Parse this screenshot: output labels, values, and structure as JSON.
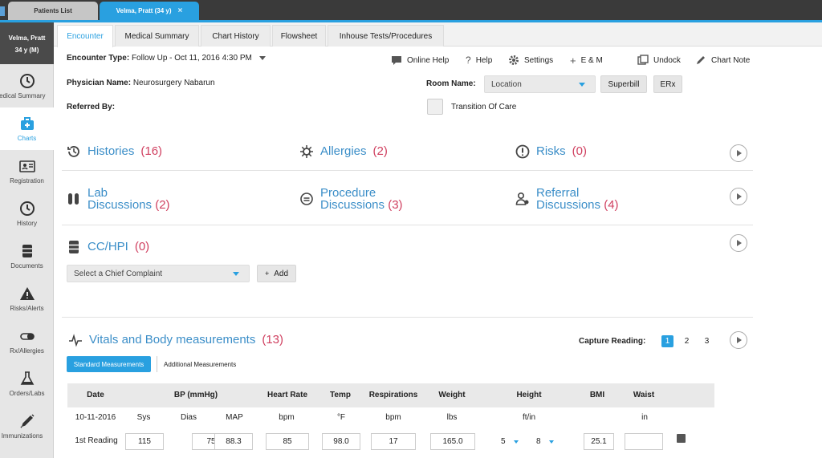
{
  "tabs": {
    "patients_list": "Patients List",
    "patient_tab": "Velma, Pratt (34 y)",
    "close": "×"
  },
  "patient": {
    "name": "Velma, Pratt",
    "age_sex": "34 y (M)"
  },
  "sidebar": {
    "items": [
      {
        "label": "Medical Summary"
      },
      {
        "label": "Charts"
      },
      {
        "label": "Registration"
      },
      {
        "label": "History"
      },
      {
        "label": "Documents"
      },
      {
        "label": "Risks/Alerts"
      },
      {
        "label": "Rx/Allergies"
      },
      {
        "label": "Orders/Labs"
      },
      {
        "label": "Immunizations"
      }
    ]
  },
  "subtabs": [
    "Encounter",
    "Medical Summary",
    "Chart History",
    "Flowsheet",
    "Inhouse Tests/Procedures"
  ],
  "encounter": {
    "type_label": "Encounter Type:",
    "type_value": "Follow Up - Oct 11, 2016 4:30 PM",
    "physician_label": "Physician Name:",
    "physician_value": "Neurosurgery Nabarun",
    "referred_label": "Referred By:",
    "room_label": "Room Name:",
    "room_placeholder": "Location",
    "transition_label": "Transition Of Care"
  },
  "toolbar": {
    "online_help": "Online Help",
    "help": "Help",
    "settings": "Settings",
    "em": "E & M",
    "undock": "Undock",
    "chart_note": "Chart Note",
    "superbill": "Superbill",
    "erx": "ERx"
  },
  "sections": {
    "histories": {
      "title": "Histories",
      "count": "(16)"
    },
    "allergies": {
      "title": "Allergies",
      "count": "(2)"
    },
    "risks": {
      "title": "Risks",
      "count": "(0)"
    },
    "lab": {
      "title1": "Lab",
      "title2": "Discussions",
      "count": "(2)"
    },
    "procedure": {
      "title1": "Procedure",
      "title2": "Discussions",
      "count": "(3)"
    },
    "referral": {
      "title1": "Referral",
      "title2": "Discussions",
      "count": "(4)"
    },
    "cchpi": {
      "title": "CC/HPI",
      "count": "(0)"
    },
    "vitals": {
      "title": "Vitals and Body measurements",
      "count": "(13)"
    }
  },
  "cchpi": {
    "select_placeholder": "Select a Chief Complaint",
    "add": "Add",
    "add_icon": "+"
  },
  "vitals": {
    "capture_label": "Capture Reading:",
    "pages": [
      "1",
      "2",
      "3"
    ],
    "tab_standard": "Standard Measurements",
    "tab_additional": "Additional Measurements",
    "headers": [
      "Date",
      "BP (mmHg)",
      "Heart Rate",
      "Temp",
      "Respirations",
      "Weight",
      "Height",
      "BMI",
      "Waist"
    ],
    "subheaders": [
      "10-11-2016",
      "Sys",
      "Dias",
      "MAP",
      "bpm",
      "°F",
      "bpm",
      "lbs",
      "ft/in",
      "in"
    ],
    "row_label": "1st Reading",
    "values": {
      "sys": "115",
      "dias": "75",
      "map": "88.3",
      "hr": "85",
      "temp": "98.0",
      "resp": "17",
      "weight": "165.0",
      "height_ft": "5",
      "height_in": "8",
      "bmi": "25.1",
      "waist": ""
    }
  }
}
